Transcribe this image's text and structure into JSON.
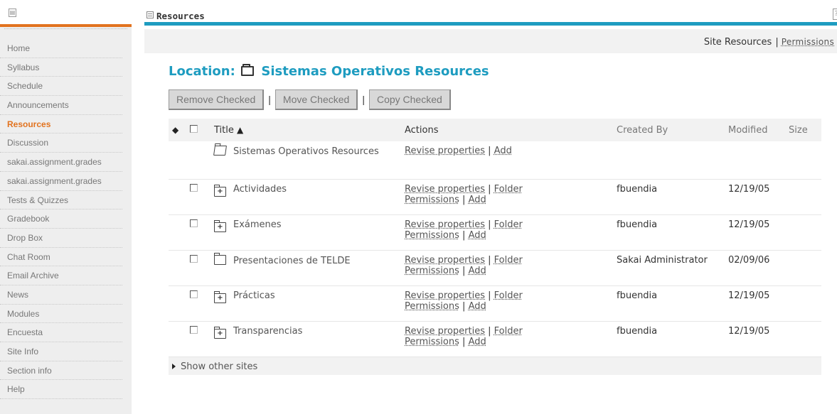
{
  "nav": {
    "items": [
      {
        "label": "Home"
      },
      {
        "label": "Syllabus"
      },
      {
        "label": "Schedule"
      },
      {
        "label": "Announcements"
      },
      {
        "label": "Resources",
        "active": true
      },
      {
        "label": "Discussion"
      },
      {
        "label": "sakai.assignment.grades"
      },
      {
        "label": "sakai.assignment.grades"
      },
      {
        "label": "Tests & Quizzes"
      },
      {
        "label": "Gradebook"
      },
      {
        "label": "Drop Box"
      },
      {
        "label": "Chat Room"
      },
      {
        "label": "Email Archive"
      },
      {
        "label": "News"
      },
      {
        "label": "Modules"
      },
      {
        "label": "Encuesta"
      },
      {
        "label": "Site Info"
      },
      {
        "label": "Section info"
      },
      {
        "label": "Help"
      }
    ]
  },
  "header": {
    "title": "Resources",
    "site_resources": "Site Resources",
    "separator": "|",
    "permissions": "Permissions"
  },
  "location": {
    "prefix": "Location:",
    "name": "Sistemas Operativos Resources"
  },
  "actions": {
    "remove": "Remove Checked",
    "move": "Move Checked",
    "copy": "Copy Checked",
    "separator": "|"
  },
  "table": {
    "headers": {
      "title": "Title",
      "actions": "Actions",
      "created_by": "Created By",
      "modified": "Modified",
      "size": "Size"
    },
    "root": {
      "title": "Sistemas Operativos Resources",
      "revise": "Revise properties",
      "add": "Add"
    },
    "rows": [
      {
        "title": "Actividades",
        "created_by": "fbuendia",
        "modified": "12/19/05",
        "expandable": true
      },
      {
        "title": "Exámenes",
        "created_by": "fbuendia",
        "modified": "12/19/05",
        "expandable": true
      },
      {
        "title": "Presentaciones de TELDE",
        "created_by": "Sakai Administrator",
        "modified": "02/09/06",
        "expandable": false
      },
      {
        "title": "Prácticas",
        "created_by": "fbuendia",
        "modified": "12/19/05",
        "expandable": true
      },
      {
        "title": "Transparencias",
        "created_by": "fbuendia",
        "modified": "12/19/05",
        "expandable": true
      }
    ],
    "row_links": {
      "revise": "Revise properties",
      "folder": "Folder",
      "permissions": "Permissions",
      "add": "Add",
      "pipe": "|"
    },
    "footer": "Show other sites"
  },
  "colors": {
    "accent": "#1e9cc0",
    "nav_active": "#e2731f"
  }
}
